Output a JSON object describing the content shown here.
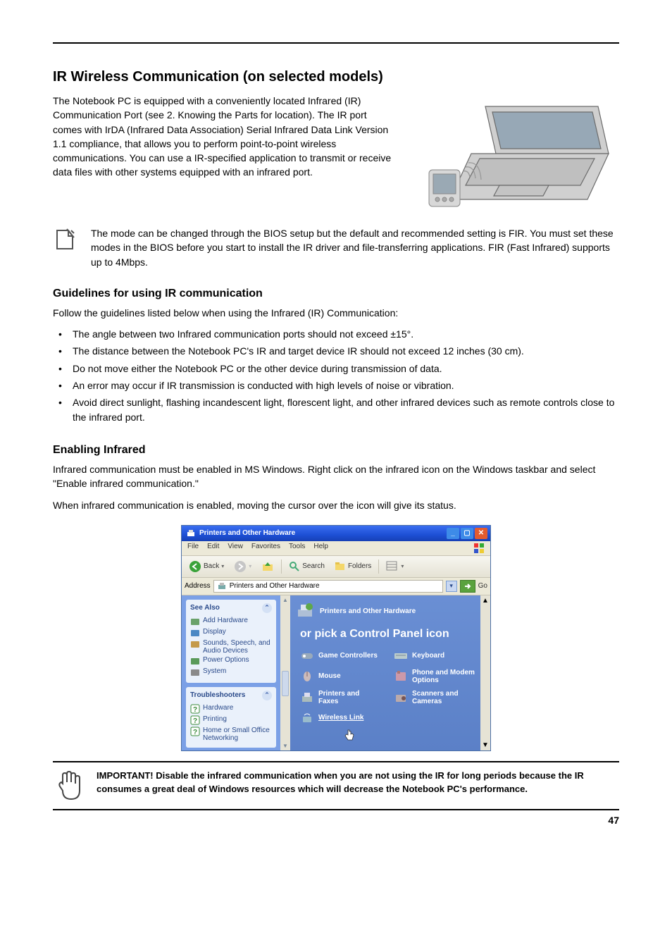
{
  "page": {
    "number": "47"
  },
  "heading": "IR Wireless Communication (on selected models)",
  "intro": "The Notebook PC is equipped with a conveniently located Infrared (IR) Communication Port (see 2. Knowing the Parts for location). The IR port comes with IrDA (Infrared Data Association) Serial Infrared Data Link Version 1.1 compliance, that allows you to perform point-to-point wireless communications. You can use a IR-specified application to transmit or receive data files with other systems equipped with an infrared port.",
  "note": "The mode can be changed through the BIOS setup but the default and recommended setting is FIR. You must set these modes in the BIOS before you start to install the IR driver and file-transferring applications. FIR (Fast Infrared) supports up to 4Mbps.",
  "guidelines_head": "Guidelines for using IR communication",
  "guidelines_intro": "Follow the guidelines listed below when using the Infrared (IR) Communication:",
  "bullets": [
    "The angle between two Infrared communication ports should not exceed ±15°.",
    "The distance between the Notebook PC's IR and target device IR should not exceed 12 inches (30 cm).",
    "Do not move either the Notebook PC or the other device during transmission of data.",
    "An error may occur if IR transmission is conducted with high levels of noise or vibration.",
    "Avoid direct sunlight, flashing incandescent light, florescent light, and other infrared devices such as remote controls close to the infrared port."
  ],
  "enabling_head": "Enabling Infrared",
  "enabling_body": "Infrared communication must be enabled in MS Windows. Right click on the infrared icon on the Windows taskbar and select \"Enable infrared communication.\"",
  "enabling_body2": "When infrared communication is enabled, moving the cursor over the icon will give its status.",
  "caution": "IMPORTANT! Disable the infrared communication when you are not using the IR for long periods because the IR consumes a great deal of Windows resources which will decrease the Notebook PC's performance.",
  "window": {
    "title": "Printers and Other Hardware",
    "menus": [
      "File",
      "Edit",
      "View",
      "Favorites",
      "Tools",
      "Help"
    ],
    "toolbar": {
      "back": "Back",
      "search": "Search",
      "folders": "Folders"
    },
    "address_label": "Address",
    "address_value": "Printers and Other Hardware",
    "go": "Go",
    "side": {
      "see_also": "See Also",
      "see_also_items": [
        "Add Hardware",
        "Display",
        "Sounds, Speech, and Audio Devices",
        "Power Options",
        "System"
      ],
      "troubleshooters": "Troubleshooters",
      "troubleshooters_items": [
        "Hardware",
        "Printing",
        "Home or Small Office Networking"
      ]
    },
    "main": {
      "header": "Printers and Other Hardware",
      "subhead": "or pick a Control Panel icon",
      "items": [
        {
          "label": "Game Controllers"
        },
        {
          "label": "Keyboard"
        },
        {
          "label": "Mouse"
        },
        {
          "label": "Phone and Modem Options"
        },
        {
          "label": "Printers and Faxes"
        },
        {
          "label": "Scanners and Cameras"
        },
        {
          "label": "Wireless Link",
          "link": true
        }
      ]
    }
  }
}
